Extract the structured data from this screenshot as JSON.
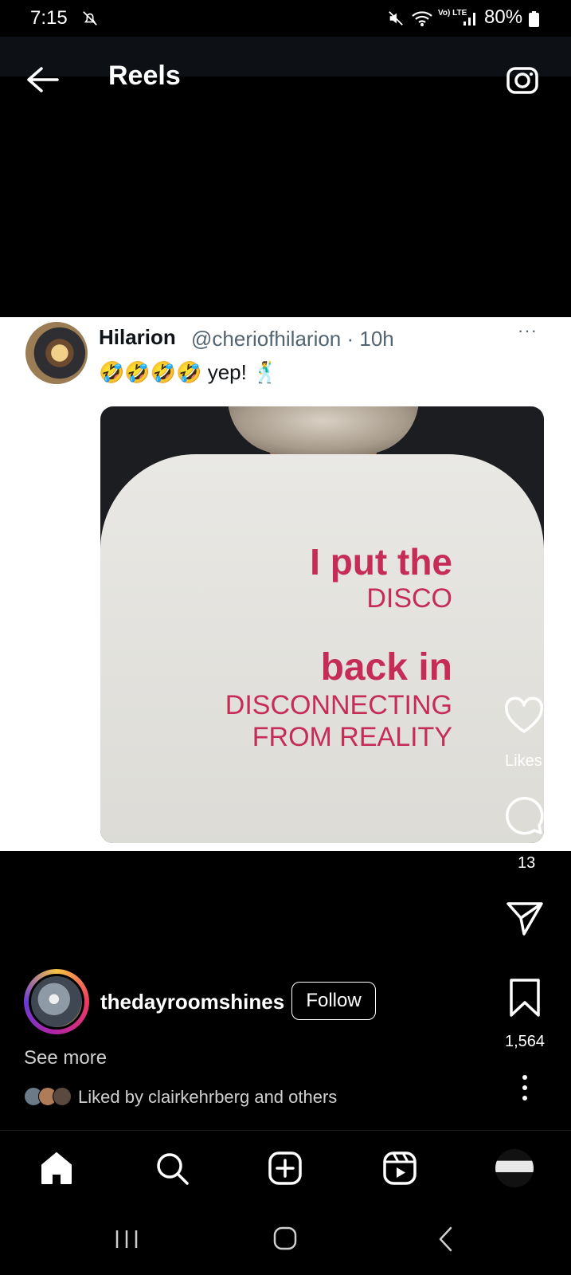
{
  "status_bar": {
    "time": "7:15",
    "network": "Vo) LTE",
    "battery": "80%"
  },
  "header": {
    "title": "Reels"
  },
  "tweet": {
    "name": "Hilarion",
    "handle": "@cheriofhilarion · 10h",
    "more": "···",
    "text": "🤣🤣🤣🤣 yep! 🕺",
    "shirt_lines": [
      "I put the",
      "DISCO",
      "back in",
      "DISCONNECTING",
      "FROM REALITY"
    ]
  },
  "actions": {
    "likes_label": "Likes",
    "comments": "13",
    "saves": "1,564"
  },
  "creator": {
    "username": "thedayroomshines",
    "follow_label": "Follow",
    "see_more": "See more",
    "liked_by": "Liked by clairkehrberg and others"
  },
  "icons": {
    "back": "back-arrow-icon",
    "camera": "camera-icon",
    "heart": "heart-icon",
    "comment": "comment-icon",
    "share": "share-icon",
    "save": "bookmark-icon",
    "more": "more-vertical-icon",
    "nav": [
      "home-icon",
      "search-icon",
      "create-icon",
      "reels-icon",
      "profile-avatar"
    ]
  },
  "colors": {
    "accent_shirt_text": "#c52d56",
    "tweet_secondary": "#536471"
  }
}
